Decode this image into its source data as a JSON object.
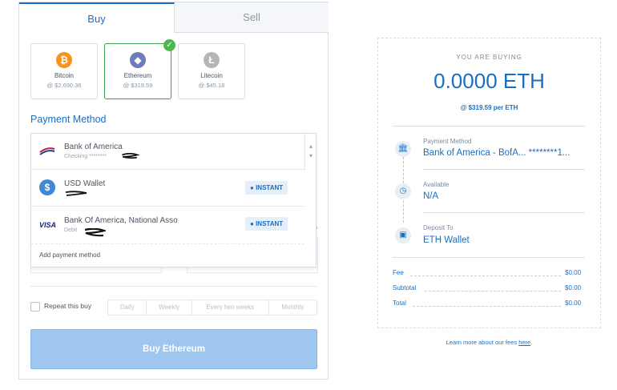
{
  "tabs": {
    "buy": "Buy",
    "sell": "Sell"
  },
  "currencies": [
    {
      "name": "Bitcoin",
      "price": "@ $2,690.36",
      "icon": "bitcoin-icon",
      "color": "#f7931a",
      "glyph": "₿"
    },
    {
      "name": "Ethereum",
      "price": "@ $319.59",
      "icon": "ethereum-icon",
      "color": "#6f7cba",
      "glyph": "◆",
      "selected": true
    },
    {
      "name": "Litecoin",
      "price": "@ $45.18",
      "icon": "litecoin-icon",
      "color": "#b5b5b5",
      "glyph": "Ł"
    }
  ],
  "payment": {
    "title": "Payment Method",
    "methods": [
      {
        "name": "Bank of America",
        "sub": "Checking ********"
      },
      {
        "name": "USD Wallet",
        "sub": "",
        "badge": "INSTANT"
      },
      {
        "name": "Bank Of America, National Asso",
        "sub": "Debit",
        "badge": "INSTANT",
        "brand": "VISA"
      }
    ],
    "add": "Add payment method",
    "limits_fragment": "mits"
  },
  "repeat": {
    "label": "Repeat this buy",
    "options": [
      "Daily",
      "Weekly",
      "Every two weeks",
      "Monthly"
    ]
  },
  "buy_button": "Buy Ethereum",
  "summary": {
    "heading": "YOU ARE BUYING",
    "amount": "0.0000 ETH",
    "rate": "@ $319.59 per ETH",
    "payment_label": "Payment Method",
    "payment_value": "Bank of America - BofA... ********1...",
    "available_label": "Available",
    "available_value": "N/A",
    "deposit_label": "Deposit To",
    "deposit_value": "ETH Wallet",
    "fees": [
      {
        "label": "Fee",
        "value": "$0.00"
      },
      {
        "label": "Subtotal",
        "value": "$0.00"
      },
      {
        "label": "Total",
        "value": "$0.00"
      }
    ]
  },
  "footer": {
    "text": "Learn more about our fees ",
    "link": "here",
    "end": "."
  },
  "colors": {
    "accent": "#1a6ec2",
    "success": "#4db84e",
    "button_disabled": "#9ec6ee"
  }
}
